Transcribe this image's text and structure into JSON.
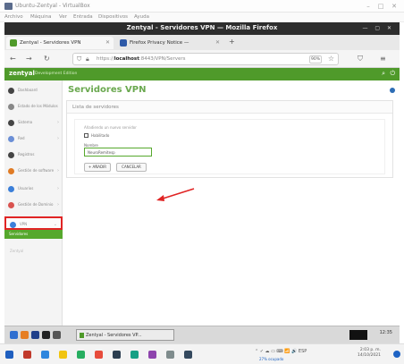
{
  "host": {
    "title": "Ubuntu-Zentyal - VirtualBox",
    "menu": [
      "Archivo",
      "Máquina",
      "Ver",
      "Entrada",
      "Dispositivos",
      "Ayuda"
    ]
  },
  "browser": {
    "window_title": "Zentyal - Servidores VPN — Mozilla Firefox",
    "tabs": [
      {
        "label": "Zentyal - Servidores VPN",
        "active": true,
        "favicon_color": "#4f9a2a"
      },
      {
        "label": "Firefox Privacy Notice —",
        "active": false,
        "favicon_color": "#2e5aa8"
      }
    ],
    "url_host": "localhost",
    "url_full": "https://localhost:8443/VPN/Servers",
    "zoom": "90%"
  },
  "app": {
    "logo": "zentyal",
    "tagline": "Development Edition"
  },
  "sidebar": {
    "items": [
      {
        "label": "Dashboard",
        "color": "#444"
      },
      {
        "label": "Estado de los Módulos",
        "color": "#888"
      },
      {
        "label": "Sistema",
        "color": "#444"
      },
      {
        "label": "Red",
        "color": "#6b8fd6"
      },
      {
        "label": "Registros",
        "color": "#444"
      },
      {
        "label": "Gestión de software",
        "color": "#e07b24"
      },
      {
        "label": "Usuarios",
        "color": "#3b7fd9"
      },
      {
        "label": "Gestión de Dominio",
        "color": "#d9534f"
      },
      {
        "label": "VPN",
        "color": "#3b7fd9"
      },
      {
        "label": "Servidores",
        "color": "#ffffff"
      }
    ],
    "footer": "Zentyal"
  },
  "main": {
    "title": "Servidores VPN",
    "list_header": "Lista de servidores",
    "form_hint": "Añadiendo un nuevo servidor",
    "enabled_label": "Habilitado",
    "name_label": "Nombre",
    "name_value": "NeuroRemitesp",
    "add_label": "+ AÑADIR",
    "cancel_label": "CANCELAR"
  },
  "guest_taskbar": {
    "window_label": "Zentyal - Servidores VP...",
    "clock": "12:35"
  },
  "host_status": {
    "status_text": "27% ocupado",
    "clock_time": "2:03 p. m.",
    "clock_date": "14/10/2021",
    "lang": "ESP"
  },
  "colors": {
    "zentyal_green": "#4f9a2a",
    "highlight_red": "#e02424",
    "title_green": "#6aa84f"
  }
}
